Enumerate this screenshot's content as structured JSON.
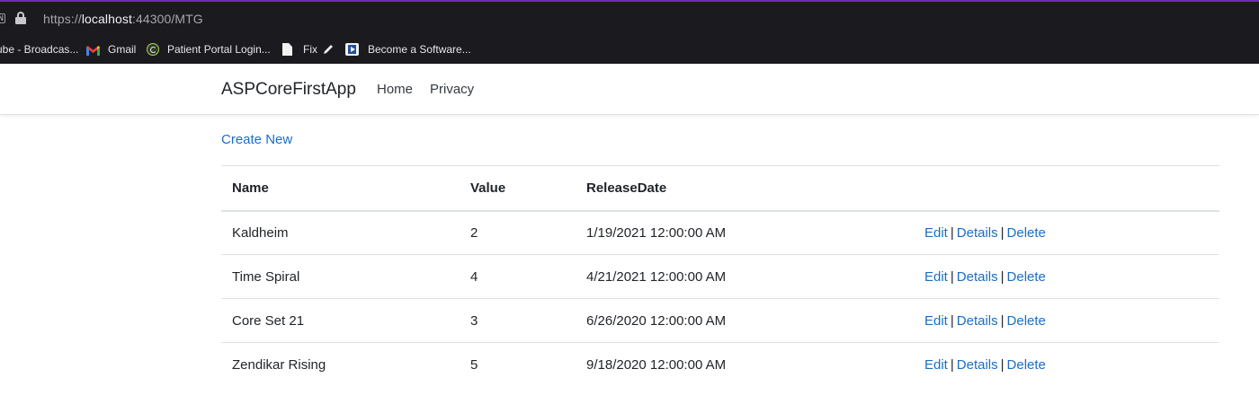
{
  "browser": {
    "site_badge": "N",
    "url_prefix": "https://",
    "url_host": "localhost",
    "url_rest": ":44300/MTG",
    "bookmarks": [
      {
        "label": "ube - Broadcas...",
        "icon": "none"
      },
      {
        "label": "Gmail",
        "icon": "gmail-icon"
      },
      {
        "label": "Patient Portal Login...",
        "icon": "portal-icon"
      },
      {
        "label": "Fix",
        "icon": "document-icon"
      },
      {
        "label": "Become a Software...",
        "icon": "video-icon"
      }
    ]
  },
  "navbar": {
    "brand": "ASPCoreFirstApp",
    "links": [
      "Home",
      "Privacy"
    ]
  },
  "main": {
    "create_link": "Create New",
    "table": {
      "headers": [
        "Name",
        "Value",
        "ReleaseDate",
        ""
      ],
      "rows": [
        {
          "name": "Kaldheim",
          "value": "2",
          "release_date": "1/19/2021 12:00:00 AM"
        },
        {
          "name": "Time Spiral",
          "value": "4",
          "release_date": "4/21/2021 12:00:00 AM"
        },
        {
          "name": "Core Set 21",
          "value": "3",
          "release_date": "6/26/2020 12:00:00 AM"
        },
        {
          "name": "Zendikar Rising",
          "value": "5",
          "release_date": "9/18/2020 12:00:00 AM"
        }
      ],
      "actions": {
        "edit": "Edit",
        "details": "Details",
        "delete": "Delete",
        "separator": "|"
      }
    }
  },
  "colors": {
    "chrome_bg": "#1b1a1f",
    "chrome_accent": "#6d2fb8",
    "link": "#1b6ec2",
    "text": "#212529",
    "border": "#dee2e6"
  }
}
